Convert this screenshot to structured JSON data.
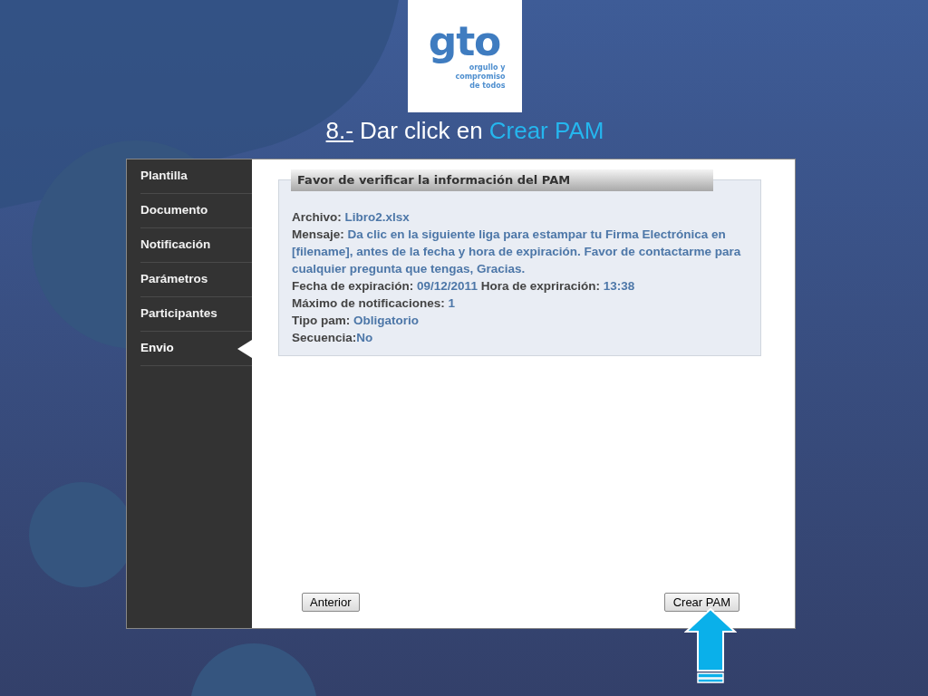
{
  "logo": {
    "wordmark": "gto",
    "tagline": [
      "orgullo y",
      "compromiso",
      "de todos"
    ]
  },
  "heading": {
    "step": "8.-",
    "text": "Dar click en",
    "highlight": "Crear PAM"
  },
  "sidebar": {
    "items": [
      {
        "label": "Plantilla",
        "selected": false
      },
      {
        "label": "Documento",
        "selected": false
      },
      {
        "label": "Notificación",
        "selected": false
      },
      {
        "label": "Parámetros",
        "selected": false
      },
      {
        "label": "Participantes",
        "selected": false
      },
      {
        "label": "Envio",
        "selected": true
      }
    ]
  },
  "panel": {
    "title": "Favor de verificar la información del PAM",
    "lines": [
      {
        "fields": [
          {
            "label": "Archivo:",
            "value": "Libro2.xlsx",
            "tight": false
          }
        ]
      },
      {
        "fields": [
          {
            "label": "Mensaje:",
            "value": "Da clic en la siguiente liga para estampar tu Firma Electrónica en [filename], antes de la fecha y hora de expiración. Favor de contactarme para cualquier pregunta que tengas, Gracias.",
            "tight": false
          }
        ]
      },
      {
        "fields": [
          {
            "label": "Fecha de expiración:",
            "value": "09/12/2011",
            "tight": false
          },
          {
            "label": "Hora de expriración:",
            "value": "13:38",
            "tight": false
          }
        ]
      },
      {
        "fields": [
          {
            "label": "Máximo de notificaciones:",
            "value": "1",
            "tight": false
          }
        ]
      },
      {
        "fields": [
          {
            "label": "Tipo pam:",
            "value": "Obligatorio",
            "tight": false
          }
        ]
      },
      {
        "fields": [
          {
            "label": "Secuencia:",
            "value": "No",
            "tight": true
          }
        ]
      }
    ]
  },
  "buttons": {
    "back": "Anterior",
    "create": "Crear PAM"
  }
}
